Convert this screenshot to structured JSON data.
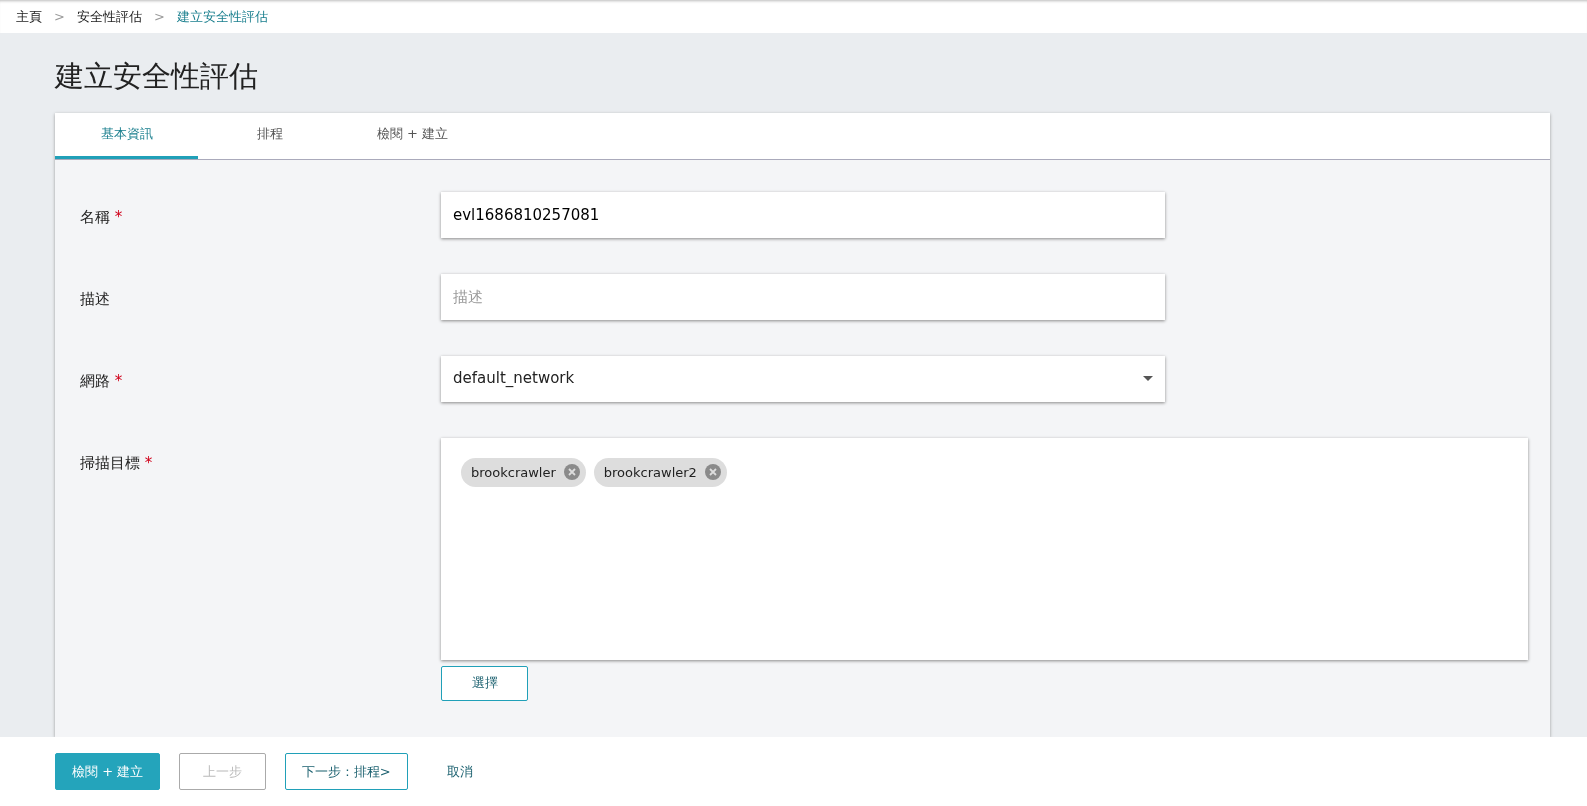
{
  "breadcrumb": [
    {
      "label": "主頁",
      "current": false
    },
    {
      "label": "安全性評估",
      "current": false
    },
    {
      "label": "建立安全性評估",
      "current": true
    }
  ],
  "breadcrumb_separator": ">",
  "required_mark": "*",
  "page_title": "建立安全性評估",
  "tabs": [
    {
      "label": "基本資訊",
      "selected": true
    },
    {
      "label": "排程",
      "selected": false
    },
    {
      "label": "檢閱 + 建立",
      "selected": false
    }
  ],
  "fields": [
    {
      "kind": "text",
      "label": "名稱",
      "required": true,
      "value": "evl1686810257081"
    },
    {
      "kind": "text",
      "label": "描述",
      "required": false,
      "placeholder": "描述"
    },
    {
      "kind": "select",
      "label": "網路",
      "required": true,
      "value": "default_network"
    },
    {
      "kind": "tags",
      "label": "掃描目標",
      "required": true,
      "tags": [
        "brookcrawler",
        "brookcrawler2"
      ],
      "button": "選擇"
    }
  ],
  "footer_buttons": [
    {
      "kind": "primary",
      "label": "檢閱 + 建立",
      "disabled": false
    },
    {
      "kind": "outline",
      "label": "上一步",
      "disabled": true
    },
    {
      "kind": "outline",
      "label": "下一步 : 排程>",
      "disabled": false
    },
    {
      "kind": "link",
      "label": "取消",
      "disabled": false
    }
  ]
}
